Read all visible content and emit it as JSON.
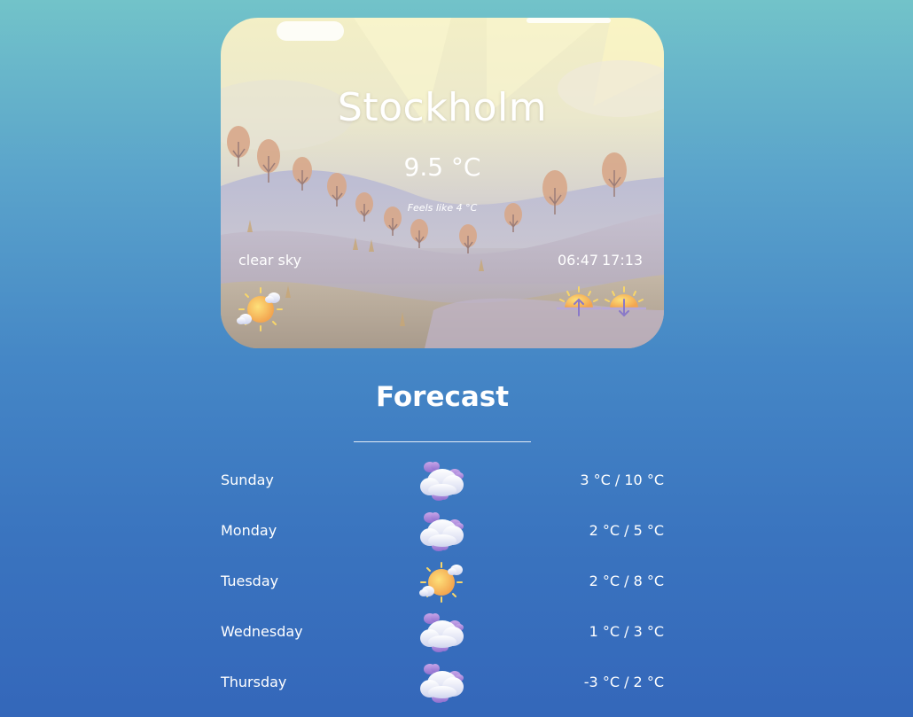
{
  "current": {
    "city": "Stockholm",
    "temperature": "9.5 °C",
    "feels_like": "Feels like 4 °C",
    "description": "clear sky",
    "sunrise": "06:47",
    "sunset": "17:13",
    "weather_icon": "sun-with-clouds-icon",
    "sunrise_icon": "sunrise-icon",
    "sunset_icon": "sunset-icon"
  },
  "forecast": {
    "title": "Forecast",
    "days": [
      {
        "day": "Sunday",
        "range": "3 °C / 10 °C",
        "icon": "cloudy-icon"
      },
      {
        "day": "Monday",
        "range": "2 °C / 5 °C",
        "icon": "cloudy-icon"
      },
      {
        "day": "Tuesday",
        "range": "2 °C / 8 °C",
        "icon": "sun-with-clouds-icon"
      },
      {
        "day": "Wednesday",
        "range": "1 °C / 3 °C",
        "icon": "cloudy-icon"
      },
      {
        "day": "Thursday",
        "range": "-3 °C / 2 °C",
        "icon": "cloudy-icon"
      }
    ]
  },
  "colors": {
    "background_top": "#72c3c9",
    "background_bottom": "#3467ba",
    "text": "#ffffff",
    "sun": "#f6b85a"
  }
}
